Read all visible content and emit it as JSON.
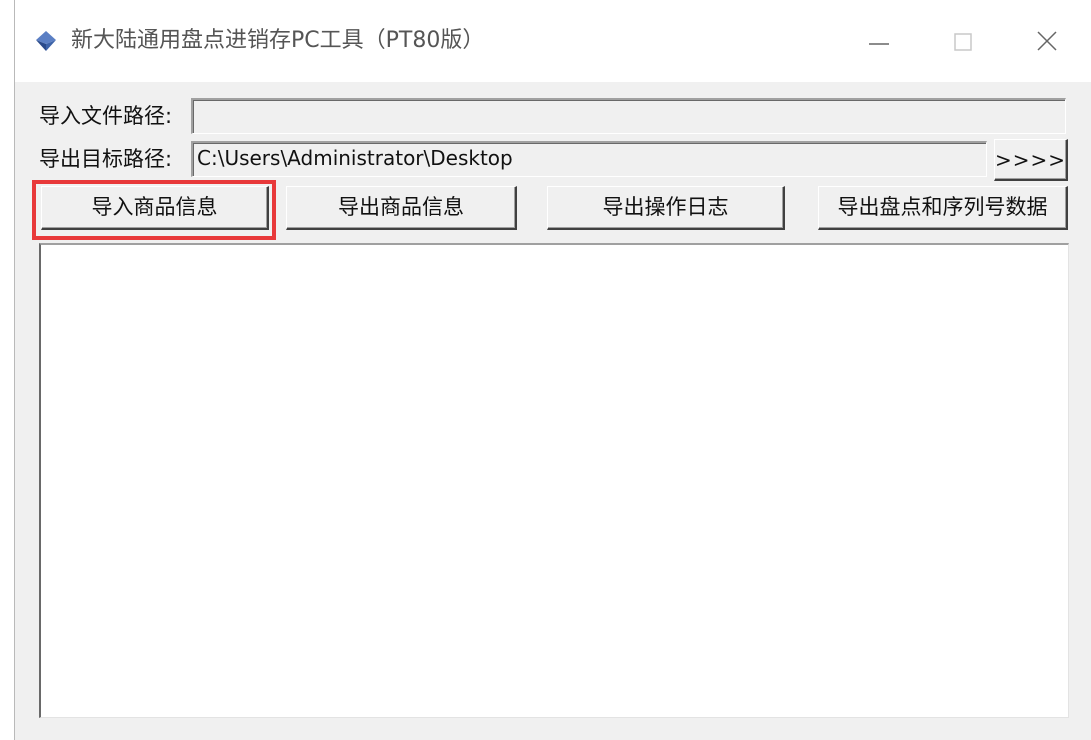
{
  "window": {
    "title": "新大陆通用盘点进销存PC工具（PT80版）",
    "minimize": "—",
    "maximize": "☐",
    "close": "✕"
  },
  "import_path": {
    "label": "导入文件路径:",
    "value": ""
  },
  "export_path": {
    "label": "导出目标路径:",
    "value": "C:\\Users\\Administrator\\Desktop",
    "browse_label": ">>>>"
  },
  "buttons": {
    "import_products": "导入商品信息",
    "export_products": "导出商品信息",
    "export_log": "导出操作日志",
    "export_inventory_serial": "导出盘点和序列号数据"
  },
  "colors": {
    "highlight": "#e8393a",
    "icon": "#3b5998"
  }
}
